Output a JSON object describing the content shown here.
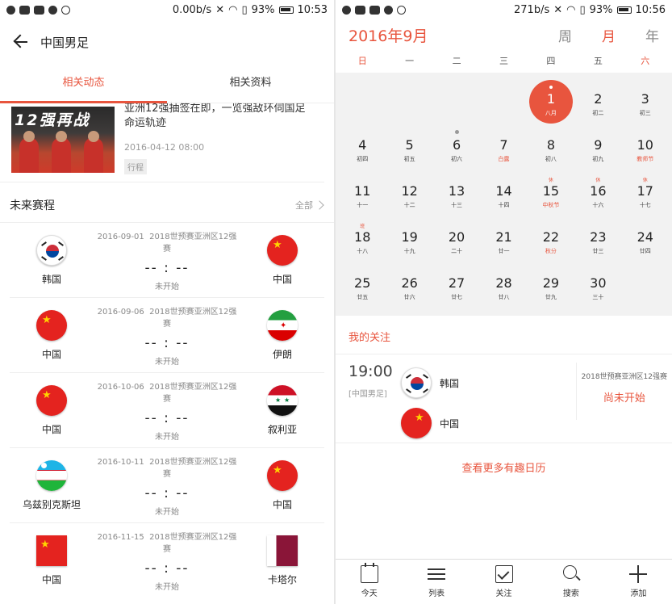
{
  "left": {
    "status": {
      "speed": "0.00b/s",
      "battery": "93%",
      "time": "10:53"
    },
    "title": "中国男足",
    "tabs": [
      "相关动态",
      "相关资料"
    ],
    "news": {
      "image_caption": "12强再战",
      "title": "亚洲12强抽签在即，一览强敌环伺国足命运轨迹",
      "date": "2016-04-12 08:00",
      "tag": "行程"
    },
    "section": {
      "title": "未来赛程",
      "all": "全部"
    },
    "matches": [
      {
        "date": "2016-09-01",
        "comp": "2018世预赛亚洲区12强赛",
        "home": "韩国",
        "away": "中国",
        "score": "-- : --",
        "status": "未开始"
      },
      {
        "date": "2016-09-06",
        "comp": "2018世预赛亚洲区12强赛",
        "home": "中国",
        "away": "伊朗",
        "score": "-- : --",
        "status": "未开始"
      },
      {
        "date": "2016-10-06",
        "comp": "2018世预赛亚洲区12强赛",
        "home": "中国",
        "away": "叙利亚",
        "score": "-- : --",
        "status": "未开始"
      },
      {
        "date": "2016-10-11",
        "comp": "2018世预赛亚洲区12强赛",
        "home": "乌兹别克斯坦",
        "away": "中国",
        "score": "-- : --",
        "status": "未开始"
      },
      {
        "date": "2016-11-15",
        "comp": "2018世预赛亚洲区12强赛",
        "home": "中国",
        "away": "卡塔尔",
        "score": "-- : --",
        "status": "未开始"
      }
    ]
  },
  "right": {
    "status": {
      "speed": "271b/s",
      "battery": "93%",
      "time": "10:56"
    },
    "month_title": "2016年9月",
    "views": [
      "周",
      "月",
      "年"
    ],
    "weekdays": [
      "日",
      "一",
      "二",
      "三",
      "四",
      "五",
      "六"
    ],
    "days": [
      {
        "d": "1",
        "l": "八月"
      },
      {
        "d": "2",
        "l": "初二"
      },
      {
        "d": "3",
        "l": "初三"
      },
      {
        "d": "4",
        "l": "初四"
      },
      {
        "d": "5",
        "l": "初五"
      },
      {
        "d": "6",
        "l": "初六"
      },
      {
        "d": "7",
        "l": "白露"
      },
      {
        "d": "8",
        "l": "初八"
      },
      {
        "d": "9",
        "l": "初九"
      },
      {
        "d": "10",
        "l": "教师节"
      },
      {
        "d": "11",
        "l": "十一"
      },
      {
        "d": "12",
        "l": "十二"
      },
      {
        "d": "13",
        "l": "十三"
      },
      {
        "d": "14",
        "l": "十四"
      },
      {
        "d": "15",
        "l": "中秋节",
        "mark": "休"
      },
      {
        "d": "16",
        "l": "十六",
        "mark": "休"
      },
      {
        "d": "17",
        "l": "十七",
        "mark": "休"
      },
      {
        "d": "18",
        "l": "十八",
        "mark": "班"
      },
      {
        "d": "19",
        "l": "十九"
      },
      {
        "d": "20",
        "l": "二十"
      },
      {
        "d": "21",
        "l": "廿一"
      },
      {
        "d": "22",
        "l": "秋分"
      },
      {
        "d": "23",
        "l": "廿三"
      },
      {
        "d": "24",
        "l": "廿四"
      },
      {
        "d": "25",
        "l": "廿五"
      },
      {
        "d": "26",
        "l": "廿六"
      },
      {
        "d": "27",
        "l": "廿七"
      },
      {
        "d": "28",
        "l": "廿八"
      },
      {
        "d": "29",
        "l": "廿九"
      },
      {
        "d": "30",
        "l": "三十"
      }
    ],
    "follow": {
      "title": "我的关注",
      "time": "19:00",
      "category": "[中国男足]",
      "home": "韩国",
      "away": "中国",
      "comp": "2018世预赛亚洲区12强赛",
      "status": "尚未开始",
      "more": "查看更多有趣日历"
    },
    "bottom": [
      "今天",
      "列表",
      "关注",
      "搜索",
      "添加"
    ]
  }
}
